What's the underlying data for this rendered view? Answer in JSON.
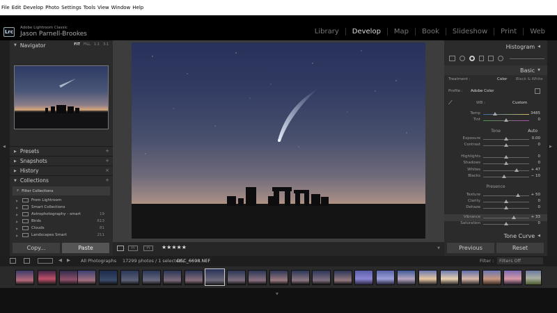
{
  "os_menu": [
    "File",
    "Edit",
    "Develop",
    "Photo",
    "Settings",
    "Tools",
    "View",
    "Window",
    "Help"
  ],
  "header": {
    "logo": "Lrc",
    "app_name": "Adobe Lightroom Classic",
    "user_name": "Jason Parnell-Brookes",
    "modules": [
      "Library",
      "Develop",
      "Map",
      "Book",
      "Slideshow",
      "Print",
      "Web"
    ],
    "active_module": "Develop"
  },
  "left_panel": {
    "navigator": {
      "title": "Navigator",
      "zoom": [
        "FIT",
        "FILL",
        "1:1",
        "3:1"
      ]
    },
    "sections": [
      "Presets",
      "Snapshots",
      "History",
      "Collections"
    ],
    "filter_label": "Filter Collections",
    "collections": [
      {
        "name": "From Lightroom",
        "count": ""
      },
      {
        "name": "Smart Collections",
        "count": ""
      },
      {
        "name": "Astrophotography - smart",
        "count": "19"
      },
      {
        "name": "Birds",
        "count": "613"
      },
      {
        "name": "Clouds",
        "count": "81"
      },
      {
        "name": "Landscapes Smart",
        "count": "211"
      }
    ],
    "copy_label": "Copy...",
    "paste_label": "Paste"
  },
  "toolbar": {
    "rating": "★★★★★"
  },
  "right_panel": {
    "histogram_title": "Histogram",
    "basic_title": "Basic",
    "treatment_label": "Treatment :",
    "treatment_color": "Color",
    "treatment_bw": "Black & White",
    "profile_label": "Profile :",
    "profile_value": "Adobe Color",
    "wb_label": "WB :",
    "wb_value": "Custom",
    "tone_label": "Tone",
    "auto_label": "Auto",
    "presence_label": "Presence",
    "sliders": [
      {
        "id": "temp",
        "label": "Temp",
        "value": "3485",
        "pos": 0.25
      },
      {
        "id": "tint",
        "label": "Tint",
        "value": "0",
        "pos": 0.5
      },
      {
        "id": "exposure",
        "label": "Exposure",
        "value": "0.00",
        "pos": 0.5
      },
      {
        "id": "contrast",
        "label": "Contrast",
        "value": "0",
        "pos": 0.5
      },
      {
        "id": "highlights",
        "label": "Highlights",
        "value": "0",
        "pos": 0.5
      },
      {
        "id": "shadows",
        "label": "Shadows",
        "value": "0",
        "pos": 0.5
      },
      {
        "id": "whites",
        "label": "Whites",
        "value": "+ 47",
        "pos": 0.73
      },
      {
        "id": "blacks",
        "label": "Blacks",
        "value": "− 10",
        "pos": 0.45
      },
      {
        "id": "texture",
        "label": "Texture",
        "value": "+ 50",
        "pos": 0.75
      },
      {
        "id": "clarity",
        "label": "Clarity",
        "value": "0",
        "pos": 0.5
      },
      {
        "id": "dehaze",
        "label": "Dehaze",
        "value": "0",
        "pos": 0.5
      },
      {
        "id": "vibrance",
        "label": "Vibrance",
        "value": "+ 33",
        "pos": 0.66
      },
      {
        "id": "saturation",
        "label": "Saturation",
        "value": "0",
        "pos": 0.5
      }
    ],
    "tone_curve_title": "Tone Curve",
    "previous_label": "Previous",
    "reset_label": "Reset"
  },
  "filmstrip_bar": {
    "source": "All Photographs",
    "info": "17299 photos / 1 selected /",
    "filename": "DSC_6698.NEF",
    "filter_label": "Filter :",
    "filter_value": "Filters Off"
  }
}
